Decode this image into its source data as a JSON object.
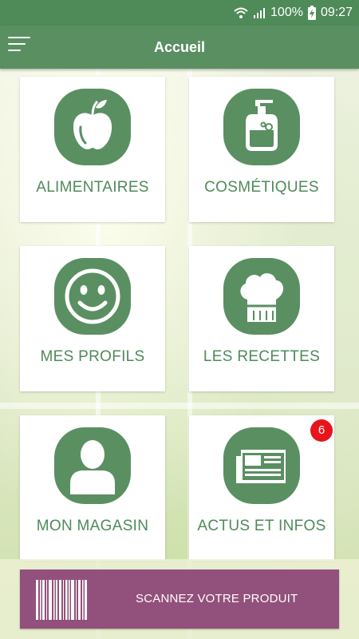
{
  "status_bar": {
    "wifi_icon": "wifi-icon",
    "signal_icon": "signal-icon",
    "battery_percent": "100%",
    "battery_icon": "battery-charging-icon",
    "time": "09:27"
  },
  "app_bar": {
    "title": "Accueil",
    "menu_icon": "hamburger-menu-icon"
  },
  "tiles": [
    {
      "label": "ALIMENTAIRES",
      "icon": "apple-icon"
    },
    {
      "label": "COSMÉTIQUES",
      "icon": "soap-bottle-icon"
    },
    {
      "label": "MES PROFILS",
      "icon": "smiley-icon"
    },
    {
      "label": "LES RECETTES",
      "icon": "chef-hat-icon"
    },
    {
      "label": "MON MAGASIN",
      "icon": "person-icon"
    },
    {
      "label": "ACTUS ET INFOS",
      "icon": "newspaper-icon",
      "badge": "6"
    }
  ],
  "scan_button": {
    "label": "SCANNEZ VOTRE PRODUIT",
    "icon": "barcode-icon"
  },
  "colors": {
    "primary_green": "#4f8a59",
    "scan_button": "#92507c",
    "badge_red": "#e8141b",
    "tile_background": "#ffffff"
  }
}
